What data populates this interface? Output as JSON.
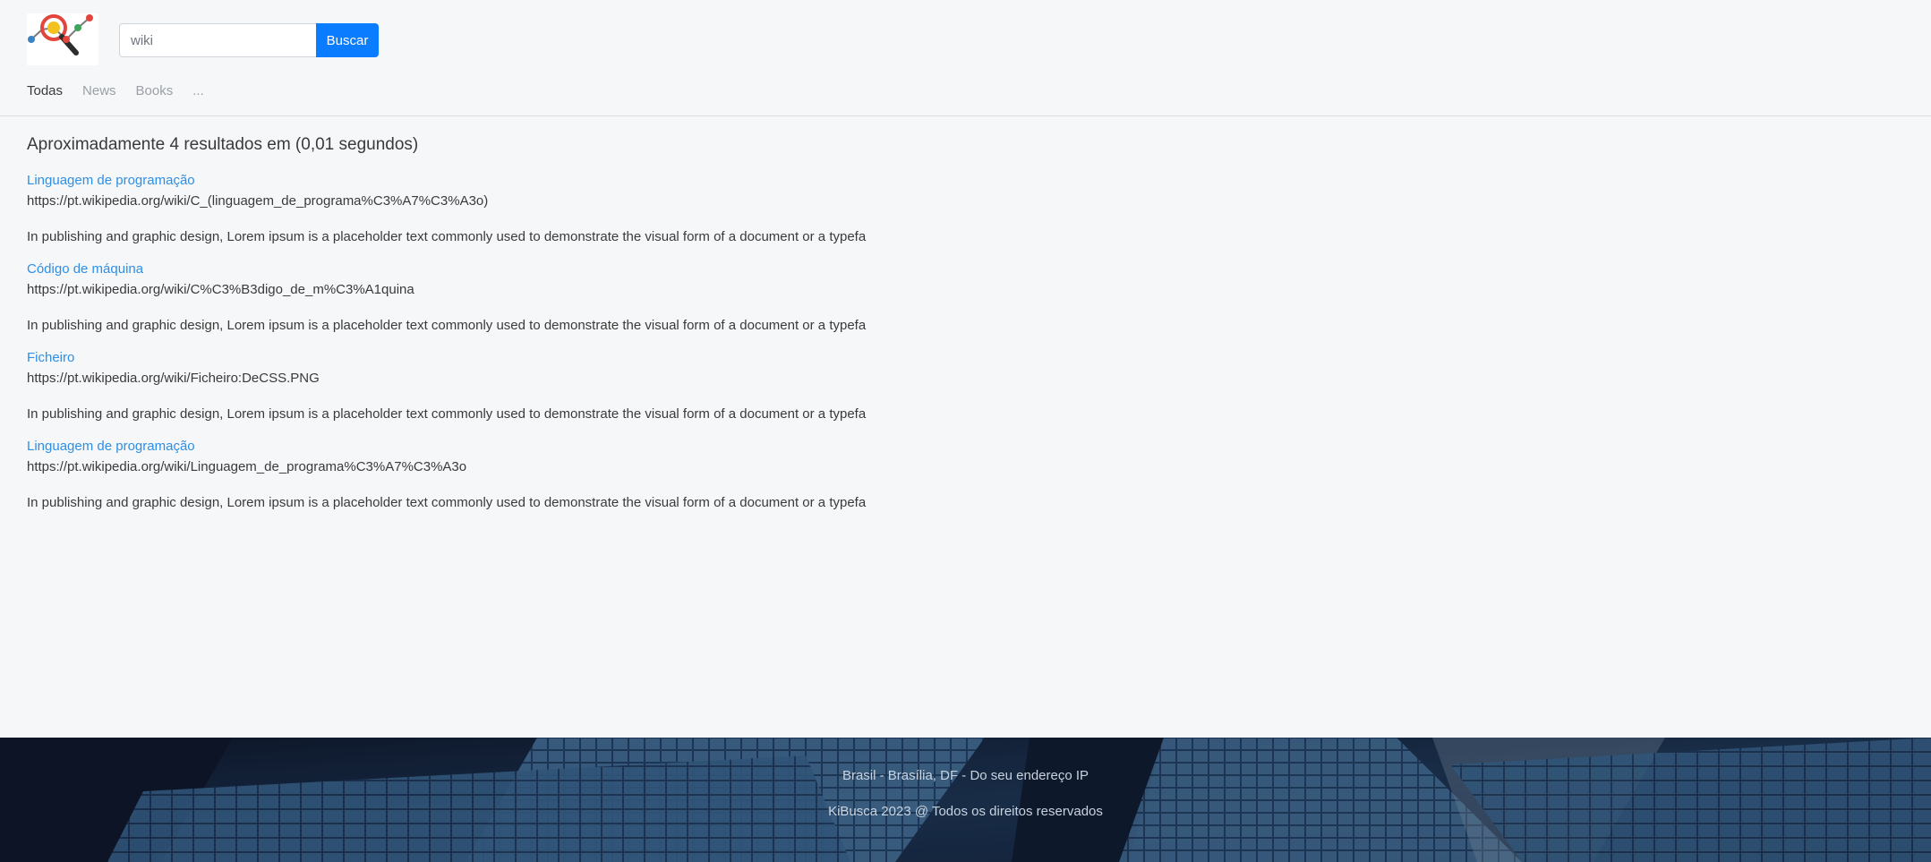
{
  "header": {
    "search": {
      "value": "wiki",
      "button_label": "Buscar"
    },
    "tabs": [
      {
        "label": "Todas",
        "active": true
      },
      {
        "label": "News",
        "active": false
      },
      {
        "label": "Books",
        "active": false
      },
      {
        "label": "...",
        "active": false
      }
    ]
  },
  "results": {
    "stats": "Aproximadamente 4 resultados em (0,01 segundos)",
    "items": [
      {
        "title": "Linguagem de programação",
        "url": "https://pt.wikipedia.org/wiki/C_(linguagem_de_programa%C3%A7%C3%A3o)",
        "snippet": "In publishing and graphic design, Lorem ipsum is a placeholder text commonly used to demonstrate the visual form of a document or a typefa"
      },
      {
        "title": "Código de máquina",
        "url": "https://pt.wikipedia.org/wiki/C%C3%B3digo_de_m%C3%A1quina",
        "snippet": "In publishing and graphic design, Lorem ipsum is a placeholder text commonly used to demonstrate the visual form of a document or a typefa"
      },
      {
        "title": "Ficheiro",
        "url": "https://pt.wikipedia.org/wiki/Ficheiro:DeCSS.PNG",
        "snippet": "In publishing and graphic design, Lorem ipsum is a placeholder text commonly used to demonstrate the visual form of a document or a typefa"
      },
      {
        "title": "Linguagem de programação",
        "url": "https://pt.wikipedia.org/wiki/Linguagem_de_programa%C3%A7%C3%A3o",
        "snippet": "In publishing and graphic design, Lorem ipsum is a placeholder text commonly used to demonstrate the visual form of a document or a typefa"
      }
    ]
  },
  "footer": {
    "location": "Brasil - Brasília, DF - Do seu endereço IP",
    "copyright": "KiBusca 2023 @ Todos os direitos reservados"
  },
  "colors": {
    "accent": "#0a7cff",
    "link": "#2d8fe6",
    "page_background": "#f6f7f9",
    "footer_background": "#0f1b2e"
  },
  "icons": {
    "logo": "magnifier-chart-logo"
  }
}
